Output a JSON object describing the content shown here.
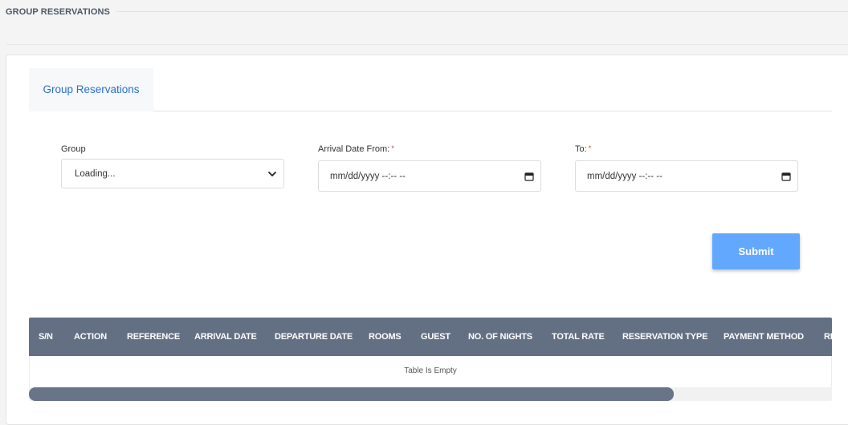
{
  "page": {
    "title": "GROUP RESERVATIONS"
  },
  "tabs": [
    {
      "label": "Group Reservations",
      "active": true
    }
  ],
  "form": {
    "group": {
      "label": "Group",
      "value": "Loading..."
    },
    "arrival_from": {
      "label": "Arrival Date From:",
      "required_mark": "*",
      "value": "mm/dd/yyyy --:-- --"
    },
    "to": {
      "label": "To:",
      "required_mark": "*",
      "value": "mm/dd/yyyy --:-- --"
    },
    "submit_label": "Submit"
  },
  "table": {
    "columns": [
      "S/N",
      "ACTION",
      "REFERENCE",
      "ARRIVAL DATE",
      "DEPARTURE DATE",
      "ROOMS",
      "GUEST",
      "NO. OF NIGHTS",
      "TOTAL RATE",
      "RESERVATION TYPE",
      "PAYMENT METHOD",
      "RE"
    ],
    "empty_text": "Table Is Empty"
  },
  "colors": {
    "accent": "#2a6fd6",
    "header_bg": "#637083",
    "submit_bg": "#62a8ff",
    "required": "#e53935"
  },
  "icons": [
    "chevron-down-icon",
    "calendar-icon"
  ]
}
